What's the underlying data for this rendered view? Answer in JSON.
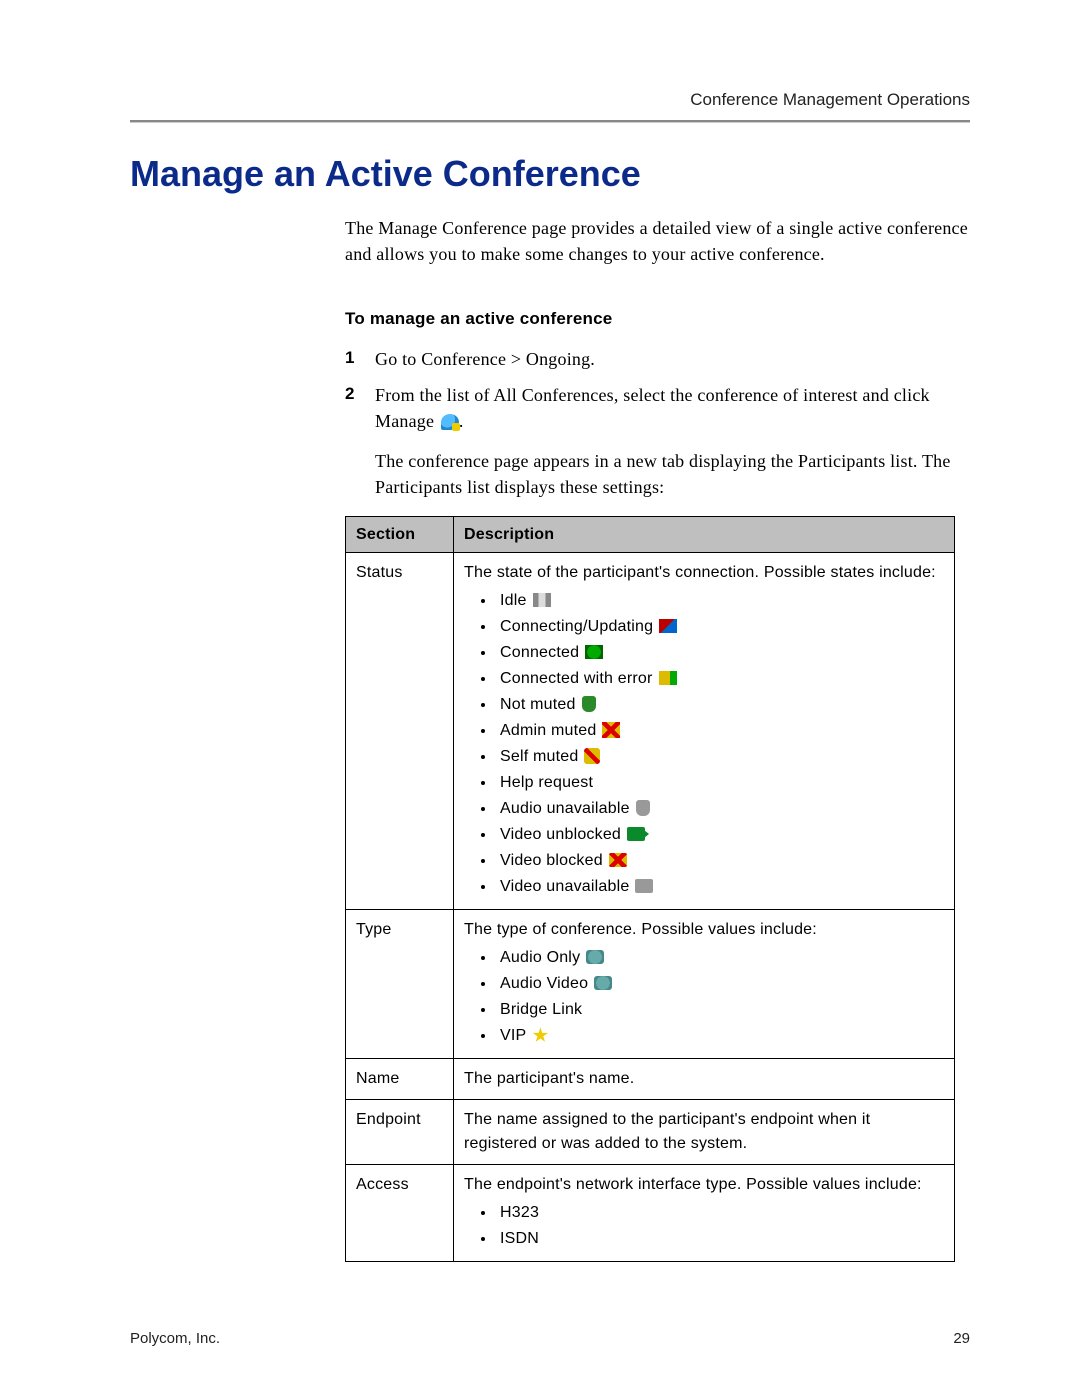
{
  "header": {
    "chapter": "Conference Management Operations"
  },
  "title": "Manage an Active Conference",
  "intro": "The Manage Conference page provides a detailed view of a single active conference and allows you to make some changes to your active conference.",
  "procedure": {
    "heading": "To manage an active conference",
    "steps": [
      {
        "n": "1",
        "text": "Go to Conference > Ongoing."
      },
      {
        "n": "2",
        "pre": "From the list of All Conferences, select the conference of interest and click Manage ",
        "post": "."
      }
    ],
    "after": "The conference page appears in a new tab displaying the Participants list. The Participants list displays these settings:"
  },
  "table": {
    "headers": [
      "Section",
      "Description"
    ],
    "rows": {
      "status": {
        "label": "Status",
        "desc": "The state of the participant's connection. Possible states include:",
        "items": [
          "Idle",
          "Connecting/Updating",
          "Connected",
          "Connected with error",
          "Not muted",
          "Admin muted",
          "Self muted",
          "Help request",
          "Audio unavailable",
          "Video unblocked",
          "Video blocked",
          "Video unavailable"
        ]
      },
      "type": {
        "label": "Type",
        "desc": "The type of conference. Possible values include:",
        "items": [
          "Audio Only",
          "Audio Video",
          "Bridge Link",
          "VIP"
        ]
      },
      "name": {
        "label": "Name",
        "desc": "The participant's name."
      },
      "endpoint": {
        "label": "Endpoint",
        "desc": "The name assigned to the participant's endpoint when it registered or was added to the system."
      },
      "access": {
        "label": "Access",
        "desc": "The endpoint's network interface type. Possible values include:",
        "items": [
          "H323",
          "ISDN"
        ]
      }
    }
  },
  "footer": {
    "left": "Polycom, Inc.",
    "right": "29"
  }
}
